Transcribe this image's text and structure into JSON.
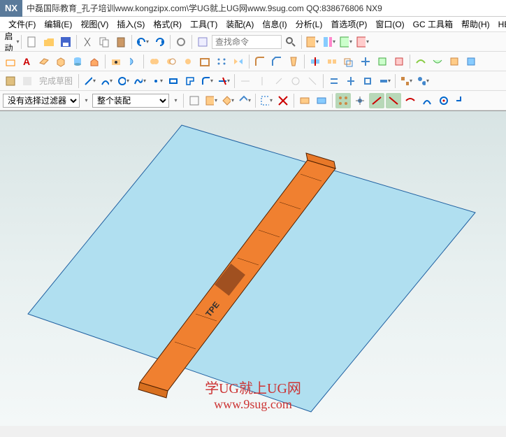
{
  "app": {
    "logo": "NX",
    "title": "中磊国际教育_孔子培训www.kongzipx.com\\学UG就上UG网www.9sug.com QQ:838676806 NX9"
  },
  "menu": {
    "file": "文件(F)",
    "edit": "编辑(E)",
    "view": "视图(V)",
    "insert": "插入(S)",
    "format": "格式(R)",
    "tools": "工具(T)",
    "assembly": "装配(A)",
    "info": "信息(I)",
    "analysis": "分析(L)",
    "preferences": "首选项(P)",
    "window": "窗口(O)",
    "gctools": "GC 工具箱",
    "help": "帮助(H)",
    "hb": "HB_I"
  },
  "toolbar1": {
    "start": "启动",
    "search_placeholder": "查找命令"
  },
  "toolbar4": {
    "sketch_label": "完成草图"
  },
  "filterbar": {
    "no_filter": "没有选择过滤器",
    "assembly_scope": "整个装配"
  },
  "watermark": {
    "line1": "学UG就上UG网",
    "line2": "www.9sug.com"
  },
  "model_text": "TPE"
}
